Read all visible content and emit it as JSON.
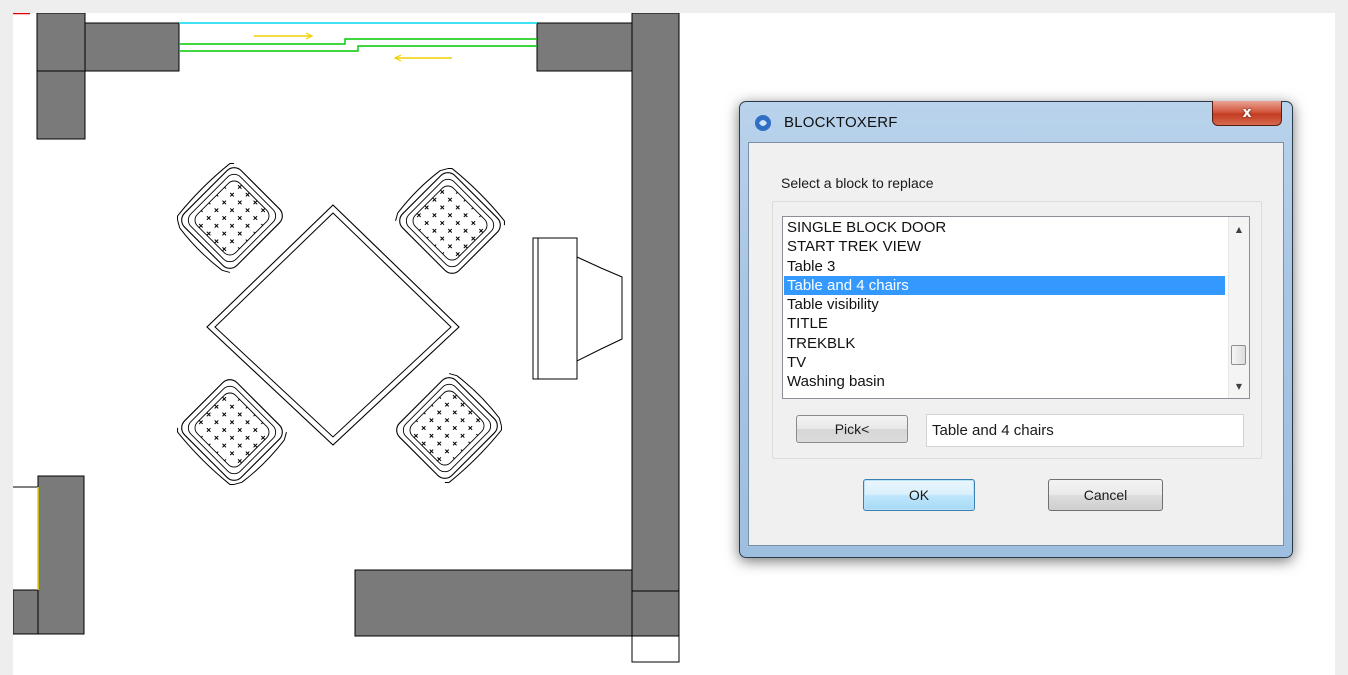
{
  "colors": {
    "wall_fill": "#7a7a7a",
    "selection_highlight": "#3399ff",
    "close_button": "#c8432a",
    "window_frame": "#a9c6e4",
    "door_line_green": "#00c800",
    "door_line_cyan": "#00d8f0",
    "arrow_yellow": "#f0d000"
  },
  "drawing": {
    "wall_icon": "wall-fill-gray",
    "chair_icon": "chair-with-cross-pattern",
    "table_icon": "diamond-table",
    "tv_icon": "tv-outline"
  },
  "dialog": {
    "title": "BLOCKTOXERF",
    "app_icon": "cad-app-icon",
    "close_glyph": "x",
    "prompt": "Select a block to replace",
    "list": {
      "items": [
        "SINGLE BLOCK DOOR",
        "START TREK VIEW",
        "Table 3",
        "Table and 4 chairs",
        "Table visibility",
        "TITLE",
        "TREKBLK",
        "TV",
        "Washing basin"
      ],
      "selected": "Table and 4 chairs",
      "scroll_up_glyph": "▲",
      "scroll_down_glyph": "▼"
    },
    "pick_button_label": "Pick<",
    "selected_value": "Table and 4 chairs",
    "ok_label": "OK",
    "cancel_label": "Cancel"
  }
}
